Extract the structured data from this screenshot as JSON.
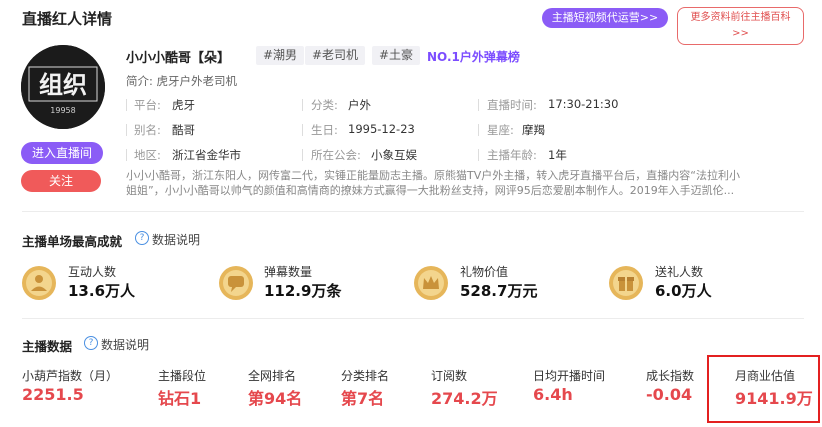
{
  "header": {
    "title": "直播红人详情",
    "ops_button": "主播短视频代运营>>",
    "more_button_line1": "更多资料前往主播百科",
    "more_button_line2": ">>"
  },
  "profile": {
    "avatar_text": "组织",
    "avatar_number": "19958",
    "enter_live": "进入直播间",
    "follow": "关注",
    "name": "小小小酷哥【朵】",
    "tags": [
      "#潮男",
      "#老司机",
      "#土豪"
    ],
    "rank_text": "NO.1户外弹幕榜",
    "intro": "简介: 虎牙户外老司机",
    "info": [
      {
        "label": "平台:",
        "value": "虎牙"
      },
      {
        "label": "分类:",
        "value": "户外"
      },
      {
        "label": "直播时间:",
        "value": "17:30-21:30"
      },
      {
        "label": "别名:",
        "value": "酷哥"
      },
      {
        "label": "生日:",
        "value": "1995-12-23"
      },
      {
        "label": "星座:",
        "value": "摩羯"
      },
      {
        "label": "地区:",
        "value": "浙江省金华市"
      },
      {
        "label": "所在公会:",
        "value": "小象互娱"
      },
      {
        "label": "主播年龄:",
        "value": "1年"
      }
    ],
    "description_line1": "小小小酷哥，浙江东阳人，网传富二代，实锤正能量励志主播。原熊猫TV户外主播，转入虎牙直播平台后，直播内容“法拉利小",
    "description_line2": "姐姐”，小小小酷哥以帅气的颜值和高情商的撩妹方式赢得一大批粉丝支持，网评95后恋爱剧本制作人。2019年入手迈凯伦..."
  },
  "achievements": {
    "title": "主播单场最高成就",
    "help": "数据说明",
    "items": [
      {
        "label": "互动人数",
        "value": "13.6万人",
        "icon": "person-medal-icon"
      },
      {
        "label": "弹幕数量",
        "value": "112.9万条",
        "icon": "chat-medal-icon"
      },
      {
        "label": "礼物价值",
        "value": "528.7万元",
        "icon": "crown-medal-icon"
      },
      {
        "label": "送礼人数",
        "value": "6.0万人",
        "icon": "gift-medal-icon"
      }
    ]
  },
  "stats": {
    "title": "主播数据",
    "help": "数据说明",
    "items": [
      {
        "label": "小葫芦指数（月）",
        "value": "2251.5"
      },
      {
        "label": "主播段位",
        "value": "钻石1"
      },
      {
        "label": "全网排名",
        "value": "第94名"
      },
      {
        "label": "分类排名",
        "value": "第7名"
      },
      {
        "label": "订阅数",
        "value": "274.2万"
      },
      {
        "label": "日均开播时间",
        "value": "6.4h"
      },
      {
        "label": "成长指数",
        "value": "-0.04"
      },
      {
        "label": "月商业估值",
        "value": "9141.9万"
      }
    ]
  },
  "colors": {
    "accent_purple": "#8b5cf6",
    "follow_red": "#f05a5a",
    "value_red": "#e5484d",
    "highlight_border": "#e32020"
  }
}
